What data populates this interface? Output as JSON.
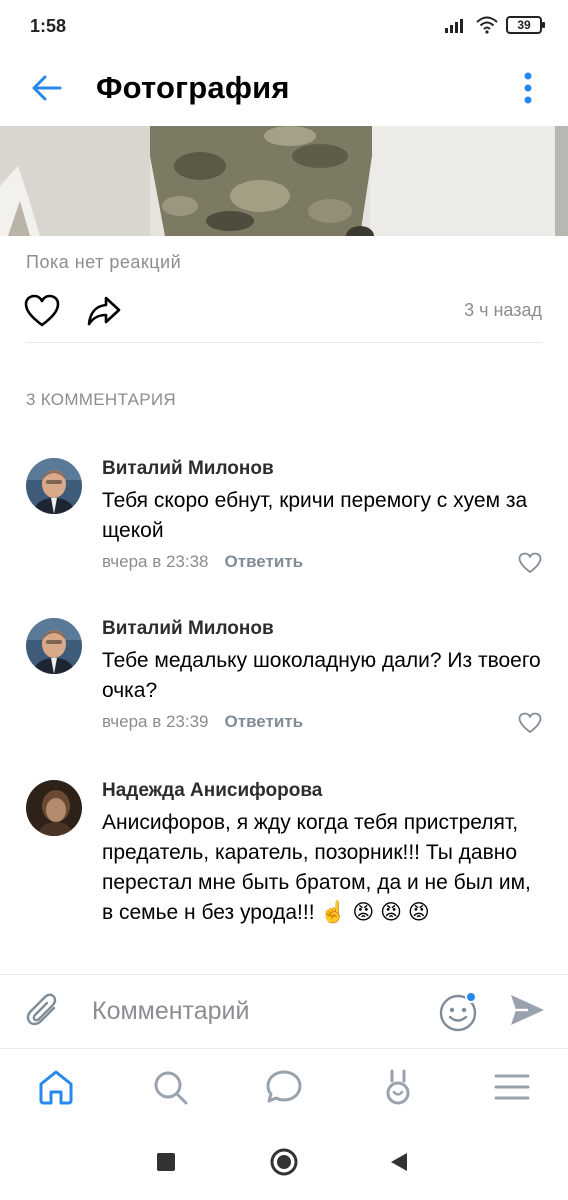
{
  "status_bar": {
    "time": "1:58",
    "battery": "39"
  },
  "header": {
    "title": "Фотография"
  },
  "post": {
    "reactions_text": "Пока нет реакций",
    "time_ago": "3 ч назад"
  },
  "comments_count": "3 КОММЕНТАРИЯ",
  "comments": [
    {
      "author": "Виталий Милонов",
      "text": "Тебя скоро ебнут, кричи перемогу с хуем за щекой",
      "date": "вчера в 23:38",
      "reply_label": "Ответить"
    },
    {
      "author": "Виталий Милонов",
      "text": "Тебе медальку шоколадную дали? Из твоего очка?",
      "date": "вчера в 23:39",
      "reply_label": "Ответить"
    },
    {
      "author": "Надежда Анисифорова",
      "text": "Анисифоров, я жду когда тебя пристрелят, предатель, каратель, позорник!!! Ты давно перестал мне быть братом, да и не был им, в семье н без урода!!! ☝️ 😡 😡 😡"
    }
  ],
  "input": {
    "placeholder": "Комментарий"
  },
  "colors": {
    "accent": "#2688eb",
    "secondary_text": "#8a8d91",
    "icon": "#818c99"
  }
}
